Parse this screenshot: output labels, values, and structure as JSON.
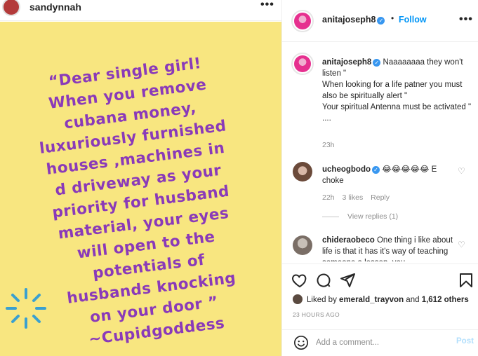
{
  "left_header": {
    "username": "sandynnah",
    "more_label": "•••"
  },
  "image": {
    "quote_lines": [
      "“Dear single girl!",
      "When you remove",
      "cubana money,",
      "luxuriously furnished",
      "houses ,machines in",
      "d driveway as your",
      "priority for husband",
      "material, your eyes",
      "will open to the",
      "potentials of",
      "husbands knocking",
      "on your door ”",
      "~Cupidgoddess"
    ],
    "colors": {
      "background": "#f8e680",
      "text": "#8a3ab9",
      "burst": "#3aa0d0"
    }
  },
  "post_header": {
    "username": "anitajoseph8",
    "separator": "•",
    "follow_label": "Follow",
    "more_label": "•••"
  },
  "caption": {
    "username": "anitajoseph8",
    "lines": [
      "Naaaaaaaa they won't listen \"",
      "When looking for a life patner you must also be spiritually alert \"",
      "Your spiritual Antenna must be activated \"",
      "...."
    ],
    "time": "23h"
  },
  "comments": [
    {
      "username": "ucheogbodo",
      "text": "😂😂😂😂😂 E choke",
      "time": "22h",
      "likes": "3 likes",
      "reply_label": "Reply",
      "view_replies": "View replies (1)"
    },
    {
      "username": "chideraobeco",
      "text": "One thing i like about life is that it has it's way of teaching someone a lesson, you"
    }
  ],
  "likes": {
    "prefix": "Liked by",
    "user": "emerald_trayvon",
    "joiner": "and",
    "others": "1,612 others"
  },
  "posted": "23 HOURS AGO",
  "add_comment": {
    "placeholder": "Add a comment...",
    "post_label": "Post"
  },
  "icons": [
    "heart-icon",
    "comment-icon",
    "share-icon",
    "bookmark-icon",
    "emoji-icon",
    "verified-icon"
  ],
  "accent": "#0095f6"
}
